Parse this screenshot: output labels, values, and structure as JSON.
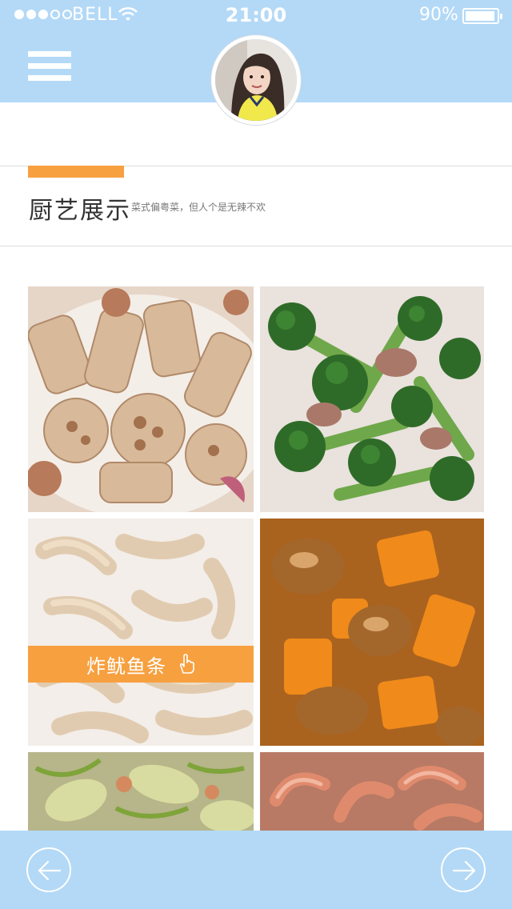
{
  "status_bar": {
    "carrier": "BELL",
    "time": "21:00",
    "battery": "90%",
    "signal_dots_filled": 3,
    "signal_dots_total": 5
  },
  "header": {
    "menu_icon": "hamburger-icon",
    "avatar": "profile-avatar"
  },
  "section": {
    "title": "厨艺展示",
    "subtitle": "菜式偏粤菜，但人个是无辣不欢"
  },
  "gallery": {
    "items": [
      {
        "dish": "lotus-root-with-pork"
      },
      {
        "dish": "broccoli-with-pork"
      },
      {
        "dish": "fried-squid-strips",
        "label": "炸鱿鱼条",
        "selected": true
      },
      {
        "dish": "pumpkin-chicken"
      },
      {
        "dish": "stir-fried-melon"
      },
      {
        "dish": "shrimp"
      }
    ]
  },
  "footer": {
    "prev_icon": "arrow-left-icon",
    "next_icon": "arrow-right-icon"
  },
  "colors": {
    "header": "#b3d9f7",
    "accent": "#f7a040",
    "text": "#333333"
  }
}
